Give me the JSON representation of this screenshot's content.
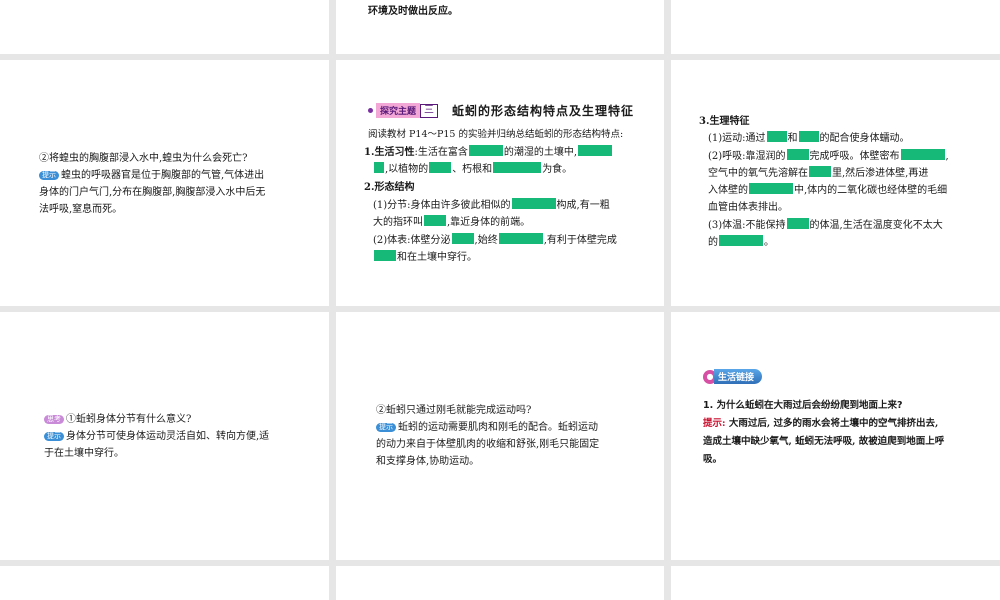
{
  "top_mid_text": "环境及时做出反应。",
  "locust": {
    "question": "②将蝗虫的胸腹部浸入水中,蝗虫为什么会死亡?",
    "hint_label": "提示",
    "hint_line1": "蝗虫的呼吸器官是位于胸腹部的气管,气体进出",
    "hint_line2": "身体的门户气门,分布在胸腹部,胸腹部浸入水中后无",
    "hint_line3": "法呼吸,窒息而死。"
  },
  "topic3": {
    "badge": "探究主题",
    "num": "三",
    "title": "蚯蚓的形态结构特点及生理特征",
    "intro": "阅读教材 P14～P15 的实验并归纳总结蚯蚓的形态结构特点:",
    "habit_label": "1.生活习性",
    "habit_a": ":生活在富含",
    "habit_b": "的潮湿的土壤中,",
    "habit_c": ",以植物的",
    "habit_d": "、朽根和",
    "habit_e": "为食。",
    "morph_label": "2.形态结构",
    "seg_a": "(1)分节:身体由许多彼此相似的",
    "seg_b": "构成,有一粗",
    "seg_c": "大的指环叫",
    "seg_d": ",靠近身体的前端。",
    "surf_a": "(2)体表:体壁分泌",
    "surf_b": ",始终",
    "surf_c": ",有利于体壁完成",
    "surf_d": "和在土壤中穿行。"
  },
  "physio": {
    "label": "3.生理特征",
    "move_a": "(1)运动:通过",
    "move_b": "和",
    "move_c": "的配合使身体蠕动。",
    "breath_a": "(2)呼吸:靠湿润的",
    "breath_b": "完成呼吸。体壁密布",
    "breath_c": ",",
    "breath_d": "空气中的氧气先溶解在",
    "breath_e": "里,然后渗进体壁,再进",
    "breath_f": "入体壁的",
    "breath_g": "中,体内的二氧化碳也经体壁的毛细",
    "breath_h": "血管由体表排出。",
    "temp_a": "(3)体温:不能保持",
    "temp_b": "的体温,生活在温度变化不太大",
    "temp_c": "的",
    "temp_d": "。"
  },
  "segment_q": {
    "think_label": "思考",
    "question": "①蚯蚓身体分节有什么意义?",
    "hint_label": "提示",
    "hint_line1": "身体分节可使身体运动灵活自如、转向方便,适",
    "hint_line2": "于在土壤中穿行。"
  },
  "bristle_q": {
    "question": "②蚯蚓只通过刚毛就能完成运动吗?",
    "hint_label": "提示",
    "hint_line1": "蚯蚓的运动需要肌肉和刚毛的配合。蚯蚓运动",
    "hint_line2": "的动力来自于体壁肌肉的收缩和舒张,刚毛只能固定",
    "hint_line3": "和支撑身体,协助运动。"
  },
  "life_link": {
    "badge": "生活链接",
    "question": "1. 为什么蚯蚓在大雨过后会纷纷爬到地面上来?",
    "hint_label": "提示:",
    "answer_line1": " 大雨过后, 过多的雨水会将土壤中的空气排挤出去,",
    "answer_line2": "造成土壤中缺少氧气, 蚯蚓无法呼吸, 故被迫爬到地面上呼",
    "answer_line3": "吸。"
  },
  "colors": {
    "blank": "#17b978",
    "hint_red": "#c8102e",
    "topic_badge": "#f2a7d6"
  }
}
